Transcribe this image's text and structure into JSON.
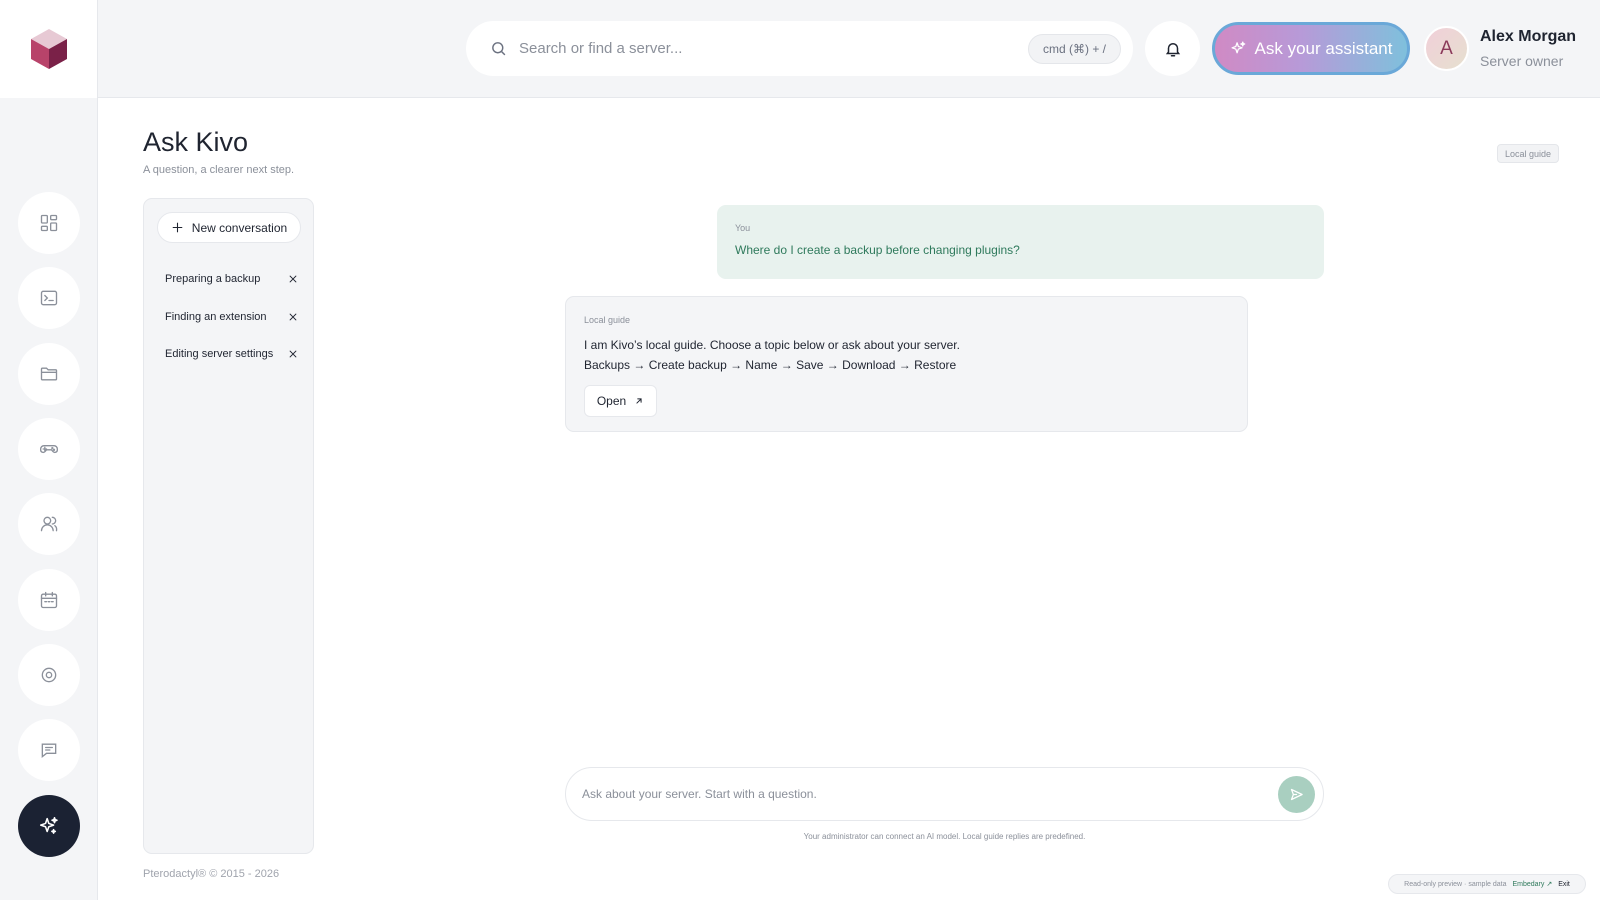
{
  "header": {
    "search": {
      "placeholder": "Search or find a server...",
      "shortcut": "cmd (⌘) + /"
    },
    "assistant_button": "Ask your assistant",
    "user": {
      "initial": "A",
      "name": "Alex Morgan",
      "role": "Server owner"
    }
  },
  "sidebar": {
    "items": [
      {
        "icon": "dashboard-icon"
      },
      {
        "icon": "terminal-icon"
      },
      {
        "icon": "folder-icon"
      },
      {
        "icon": "gamepad-icon"
      },
      {
        "icon": "users-icon"
      },
      {
        "icon": "calendar-icon"
      },
      {
        "icon": "settings-icon"
      },
      {
        "icon": "chat-icon"
      },
      {
        "icon": "sparkles-icon",
        "active": true
      }
    ]
  },
  "page": {
    "title": "Ask Kivo",
    "subtitle": "A question, a clearer next step.",
    "tag": "Local guide"
  },
  "conversations": {
    "new_label": "New conversation",
    "items": [
      {
        "label": "Preparing a backup"
      },
      {
        "label": "Finding an extension"
      },
      {
        "label": "Editing server settings"
      }
    ]
  },
  "chat": {
    "messages": [
      {
        "author": "You",
        "text": "Where do I create a backup before changing plugins?"
      },
      {
        "author": "Local guide",
        "text_line1": "I am Kivo’s local guide. Choose a topic below or ask about your server.",
        "text_line2": "Backups → Create backup → Name → Save → Download → Restore",
        "action": "Open"
      }
    ],
    "composer_placeholder": "Ask about your server. Start with a question.",
    "note": "Your administrator can connect an AI model. Local guide replies are predefined."
  },
  "footer": {
    "copyright": "Pterodactyl® © 2015 - 2026",
    "preview_text": "Read-only preview · sample data",
    "preview_link": "Embedary ↗",
    "preview_exit": "Exit"
  },
  "colors": {
    "accent": "#2f7a5c",
    "active_rail": "#1b2233",
    "assistant_gradient": [
      "#d08ac4",
      "#b79ad8",
      "#7fc0dc"
    ]
  }
}
